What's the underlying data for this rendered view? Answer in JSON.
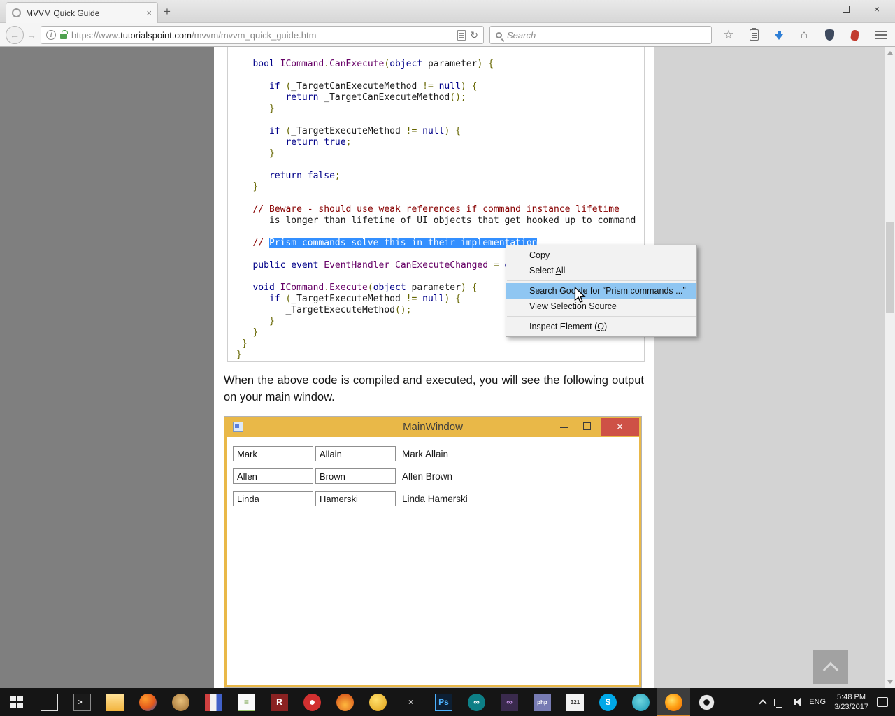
{
  "colors": {
    "selection": "#338fff",
    "menu_highlight": "#8fc6f2",
    "mainwindow_titlebar": "#e9b848",
    "mainwindow_close": "#ce5146",
    "download_accent": "#2f7fd6"
  },
  "browser": {
    "tab_title": "MVVM Quick Guide",
    "tab_close": "×",
    "new_tab": "+",
    "window": {
      "minimize": "–",
      "close": "×"
    },
    "nav": {
      "back": "←",
      "forward": "→",
      "refresh": "↻"
    },
    "url": {
      "scheme": "https://www.",
      "domain": "tutorialspoint.com",
      "path": "/mvvm/mvvm_quick_guide.htm"
    },
    "search_placeholder": "Search"
  },
  "code": {
    "lines": [
      [
        [
          "k",
          "   bool"
        ],
        [
          "n",
          " "
        ],
        [
          "t",
          "ICommand"
        ],
        [
          "p",
          "."
        ],
        [
          "t",
          "CanExecute"
        ],
        [
          "p",
          "("
        ],
        [
          "k",
          "object"
        ],
        [
          "n",
          " parameter"
        ],
        [
          "p",
          ") {"
        ]
      ],
      [],
      [
        [
          "n",
          "      "
        ],
        [
          "k",
          "if"
        ],
        [
          "n",
          " "
        ],
        [
          "p",
          "("
        ],
        [
          "n",
          "_TargetCanExecuteMethod "
        ],
        [
          "p",
          "!="
        ],
        [
          "n",
          " "
        ],
        [
          "k",
          "null"
        ],
        [
          "p",
          ") {"
        ]
      ],
      [
        [
          "n",
          "         "
        ],
        [
          "k",
          "return"
        ],
        [
          "n",
          " _TargetCanExecuteMethod"
        ],
        [
          "p",
          "();"
        ]
      ],
      [
        [
          "n",
          "      "
        ],
        [
          "p",
          "}"
        ]
      ],
      [],
      [
        [
          "n",
          "      "
        ],
        [
          "k",
          "if"
        ],
        [
          "n",
          " "
        ],
        [
          "p",
          "("
        ],
        [
          "n",
          "_TargetExecuteMethod "
        ],
        [
          "p",
          "!="
        ],
        [
          "n",
          " "
        ],
        [
          "k",
          "null"
        ],
        [
          "p",
          ") {"
        ]
      ],
      [
        [
          "n",
          "         "
        ],
        [
          "k",
          "return"
        ],
        [
          "n",
          " "
        ],
        [
          "k",
          "true"
        ],
        [
          "p",
          ";"
        ]
      ],
      [
        [
          "n",
          "      "
        ],
        [
          "p",
          "}"
        ]
      ],
      [],
      [
        [
          "n",
          "      "
        ],
        [
          "k",
          "return"
        ],
        [
          "n",
          " "
        ],
        [
          "k",
          "false"
        ],
        [
          "p",
          ";"
        ]
      ],
      [
        [
          "n",
          "   "
        ],
        [
          "p",
          "}"
        ]
      ],
      [],
      [
        [
          "c",
          "   // Beware - should use weak references if command instance lifetime"
        ]
      ],
      [
        [
          "n",
          "      is longer than lifetime of UI objects that get hooked up to command"
        ]
      ],
      [],
      [
        [
          "c",
          "   // "
        ],
        [
          "sel",
          "Prism commands solve this in their implementation"
        ]
      ],
      [],
      [
        [
          "n",
          "   "
        ],
        [
          "k",
          "public"
        ],
        [
          "n",
          " "
        ],
        [
          "k",
          "event"
        ],
        [
          "n",
          " "
        ],
        [
          "t",
          "EventHandler"
        ],
        [
          "n",
          " "
        ],
        [
          "t",
          "CanExecuteChanged"
        ],
        [
          "n",
          " "
        ],
        [
          "p",
          "="
        ],
        [
          "n",
          " "
        ],
        [
          "k",
          "delegate"
        ],
        [
          "n",
          " "
        ],
        [
          "p",
          "{ };"
        ]
      ],
      [],
      [
        [
          "n",
          "   "
        ],
        [
          "k",
          "void"
        ],
        [
          "n",
          " "
        ],
        [
          "t",
          "ICommand"
        ],
        [
          "p",
          "."
        ],
        [
          "t",
          "Execute"
        ],
        [
          "p",
          "("
        ],
        [
          "k",
          "object"
        ],
        [
          "n",
          " parameter"
        ],
        [
          "p",
          ") {"
        ]
      ],
      [
        [
          "n",
          "      "
        ],
        [
          "k",
          "if"
        ],
        [
          "n",
          " "
        ],
        [
          "p",
          "("
        ],
        [
          "n",
          "_TargetExecuteMethod "
        ],
        [
          "p",
          "!="
        ],
        [
          "n",
          " "
        ],
        [
          "k",
          "null"
        ],
        [
          "p",
          ") {"
        ]
      ],
      [
        [
          "n",
          "         _TargetExecuteMethod"
        ],
        [
          "p",
          "();"
        ]
      ],
      [
        [
          "n",
          "      "
        ],
        [
          "p",
          "}"
        ]
      ],
      [
        [
          "n",
          "   "
        ],
        [
          "p",
          "}"
        ]
      ],
      [
        [
          "n",
          " "
        ],
        [
          "p",
          "}"
        ]
      ],
      [
        [
          "p",
          "}"
        ]
      ]
    ]
  },
  "context_menu": {
    "items": [
      {
        "pre": "",
        "key": "C",
        "post": "opy"
      },
      {
        "pre": "Select ",
        "key": "A",
        "post": "ll"
      },
      {
        "type": "separator"
      },
      {
        "pre": "Search Goo",
        "key": "g",
        "post": "le for “Prism commands ...”",
        "highlighted": true
      },
      {
        "pre": "Vie",
        "key": "w",
        "post": " Selection Source"
      },
      {
        "type": "separator"
      },
      {
        "pre": "Inspect Element (",
        "key": "Q",
        "post": ")"
      }
    ]
  },
  "article": {
    "paragraph": "When the above code is compiled and executed, you will see the following output on your main window."
  },
  "app_window": {
    "title": "MainWindow",
    "close": "×",
    "rows": [
      {
        "first": "Mark",
        "last": "Allain",
        "full": "Mark Allain"
      },
      {
        "first": "Allen",
        "last": "Brown",
        "full": "Allen Brown"
      },
      {
        "first": "Linda",
        "last": "Hamerski",
        "full": "Linda Hamerski"
      }
    ]
  },
  "taskbar": {
    "apps": [
      {
        "name": "tablet-mode-icon",
        "glyph": "",
        "bg": "transparent",
        "outline": "#e0e0e0"
      },
      {
        "name": "command-prompt-icon",
        "glyph": ">_",
        "bg": "#1a1a1a",
        "fg": "#e8e8e8",
        "outline": "#8a8a8a"
      },
      {
        "name": "file-explorer-icon",
        "glyph": "",
        "bg": "linear-gradient(180deg,#ffe39a 0%,#f2b33d 100%)"
      },
      {
        "name": "app-icon-1",
        "glyph": "",
        "bg": "radial-gradient(circle at 35% 30%,#ff9d2e 0%,#e2591c 55%,#1d56c8 100%)",
        "round": true
      },
      {
        "name": "app-icon-2",
        "glyph": "",
        "bg": "radial-gradient(circle at 50% 40%,#e8c07a,#9a6a2f)",
        "round": true
      },
      {
        "name": "app-icon-3",
        "glyph": "",
        "bg": "linear-gradient(90deg,#d04040 0 33%,#f2f2f2 33% 66%,#4060c8 66% 100%)"
      },
      {
        "name": "app-icon-4",
        "glyph": "≡",
        "bg": "#fafafa",
        "fg": "#6a9a3a",
        "outline": "#9ac46a"
      },
      {
        "name": "app-icon-r",
        "glyph": "R",
        "bg": "#8a2222",
        "fg": "#ffffff"
      },
      {
        "name": "app-icon-5",
        "glyph": "",
        "bg": "radial-gradient(circle,#ffffff 0 18%,#d23030 20% 100%)",
        "round": true
      },
      {
        "name": "app-icon-6",
        "glyph": "",
        "bg": "radial-gradient(circle at 50% 65%,#ffb83d,#d04515)",
        "round": true
      },
      {
        "name": "app-icon-7",
        "glyph": "",
        "bg": "radial-gradient(circle at 40% 35%,#ffdf6b,#dfa017)",
        "round": true
      },
      {
        "name": "app-icon-tools",
        "glyph": "×",
        "bg": "transparent",
        "fg": "#c9c9c9"
      },
      {
        "name": "photoshop-icon",
        "glyph": "Ps",
        "bg": "#0d1f33",
        "fg": "#4db3ff",
        "outline": "#4db3ff"
      },
      {
        "name": "app-icon-8",
        "glyph": "∞",
        "bg": "#0d7f86",
        "fg": "#ffffff",
        "round": true
      },
      {
        "name": "visual-studio-icon",
        "glyph": "∞",
        "bg": "#3a2a4d",
        "fg": "#c490e4"
      },
      {
        "name": "app-icon-9",
        "glyph": "php",
        "bg": "#777bb3",
        "fg": "#ffffff"
      },
      {
        "name": "calculator-icon",
        "glyph": "321",
        "bg": "#f2f2f2",
        "fg": "#333333"
      },
      {
        "name": "app-icon-10",
        "glyph": "S",
        "bg": "#00a8e8",
        "fg": "#ffffff",
        "round": true
      },
      {
        "name": "app-icon-11",
        "glyph": "",
        "bg": "radial-gradient(circle at 45% 40%,#6fd6e0,#1796b4)",
        "round": true
      },
      {
        "name": "firefox-icon",
        "glyph": "",
        "bg": "radial-gradient(circle at 40% 38%,#ffe066 0%,#ffa216 45%,#e66000 100%)",
        "round": true,
        "active": true
      },
      {
        "name": "settings-gear-icon",
        "glyph": "",
        "bg": "radial-gradient(circle,#141414 0 22%,#e8e8e8 26% 58%,transparent 62%)",
        "round": true
      }
    ],
    "tray": {
      "lang": "ENG",
      "time": "5:48 PM",
      "date": "3/23/2017"
    }
  }
}
